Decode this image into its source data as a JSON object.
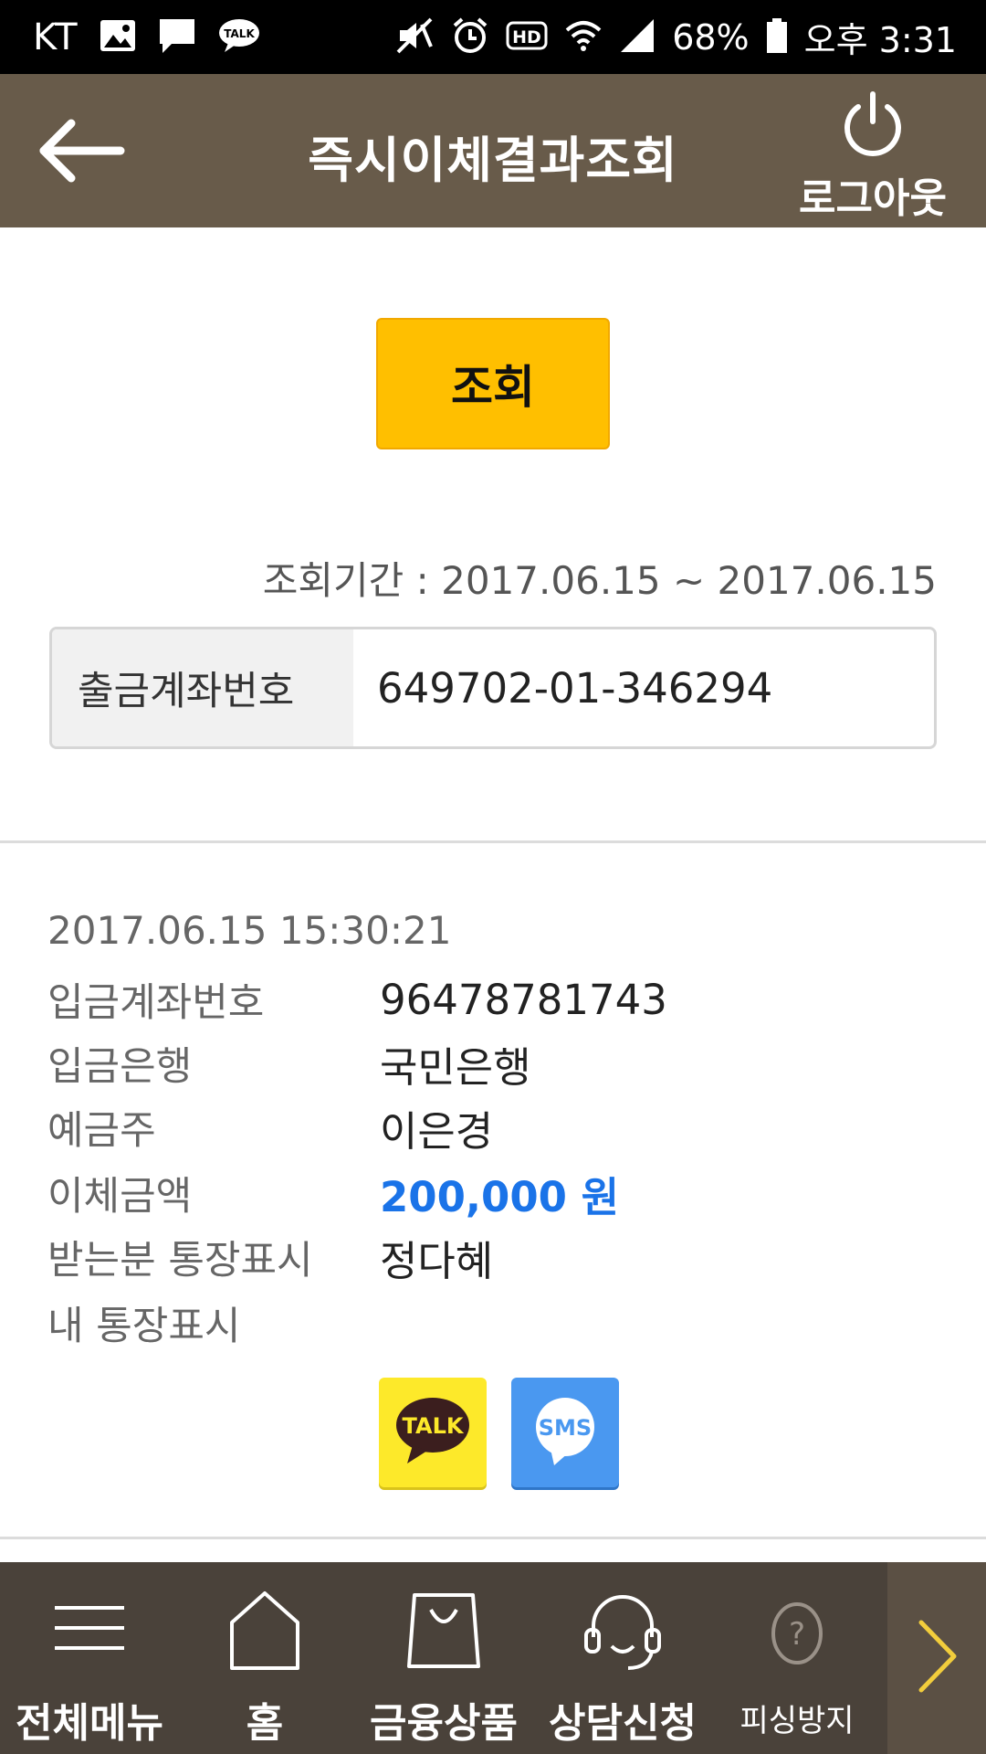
{
  "status_bar": {
    "carrier": "KT",
    "battery_percent": "68%",
    "clock": "오후 3:31",
    "icons": [
      "gallery-icon",
      "message-icon",
      "kakaotalk-icon",
      "vibrate-mute-icon",
      "alarm-icon",
      "hd-icon",
      "wifi-icon",
      "signal-icon",
      "battery-icon"
    ]
  },
  "header": {
    "title": "즉시이체결과조회",
    "back_icon": "arrow-left-icon",
    "logout_label": "로그아웃",
    "logout_icon": "power-icon",
    "background": "#685b4a"
  },
  "query": {
    "button_label": "조회",
    "button_color": "#ffbf00",
    "period_text": "조회기간 : 2017.06.15 ~ 2017.06.15"
  },
  "withdraw_account": {
    "label": "출금계좌번호",
    "value": "649702-01-346294"
  },
  "transfer": {
    "timestamp": "2017.06.15 15:30:21",
    "rows": [
      {
        "label": "입금계좌번호",
        "value": "96478781743"
      },
      {
        "label": "입금은행",
        "value": "국민은행"
      },
      {
        "label": "예금주",
        "value": "이은경"
      },
      {
        "label": "이체금액",
        "value": "200,000 원"
      },
      {
        "label": "받는분 통장표시",
        "value": "정다혜"
      },
      {
        "label": "내 통장표시",
        "value": ""
      }
    ],
    "amount_color": "#1a73e8",
    "share": {
      "talk_label": "TALK",
      "sms_label": "SMS"
    }
  },
  "bottom_nav": {
    "items": [
      {
        "label": "전체메뉴",
        "icon": "hamburger-menu-icon"
      },
      {
        "label": "홈",
        "icon": "home-icon"
      },
      {
        "label": "금융상품",
        "icon": "shopping-bag-icon"
      },
      {
        "label": "상담신청",
        "icon": "headset-icon"
      },
      {
        "label": "피싱방지",
        "icon": "question-circle-icon"
      }
    ],
    "next_icon": "chevron-right-icon",
    "accent": "#f2cd3c"
  }
}
